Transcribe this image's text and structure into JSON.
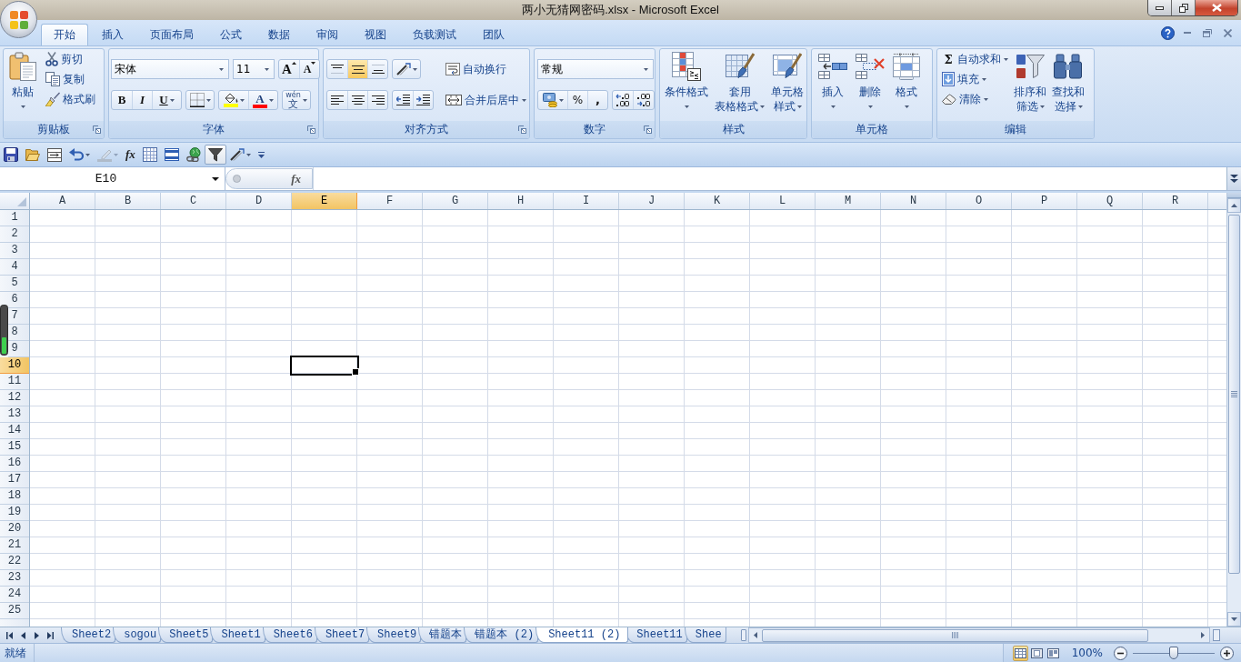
{
  "window": {
    "title": "两小无猜网密码.xlsx - Microsoft Excel"
  },
  "ribbon_tabs": [
    {
      "label": "开始",
      "selected": true
    },
    {
      "label": "插入",
      "selected": false
    },
    {
      "label": "页面布局",
      "selected": false
    },
    {
      "label": "公式",
      "selected": false
    },
    {
      "label": "数据",
      "selected": false
    },
    {
      "label": "审阅",
      "selected": false
    },
    {
      "label": "视图",
      "selected": false
    },
    {
      "label": "负载测试",
      "selected": false
    },
    {
      "label": "团队",
      "selected": false
    }
  ],
  "ribbon_groups": [
    {
      "title": "剪贴板",
      "launcher": true,
      "columns": [
        {
          "kind": "large",
          "lines": [
            "粘贴"
          ],
          "menu": true
        },
        {
          "kind": "stack",
          "rows": [
            {
              "controls": [
                {
                  "kind": "small",
                  "label": "剪切"
                }
              ]
            },
            {
              "controls": [
                {
                  "kind": "small",
                  "label": "复制"
                }
              ]
            },
            {
              "controls": [
                {
                  "kind": "small",
                  "label": "格式刷"
                }
              ]
            }
          ]
        }
      ]
    },
    {
      "title": "字体",
      "launcher": true,
      "columns": [
        {
          "kind": "stack",
          "rows": [
            {
              "controls": [
                {
                  "kind": "combo",
                  "value": "宋体"
                },
                {
                  "kind": "combo",
                  "value": "11"
                },
                {
                  "kind": "segmented",
                  "buttons": [
                    {
                      "text": "A",
                      "selected": false
                    },
                    {
                      "text": "A",
                      "selected": false
                    }
                  ]
                }
              ]
            },
            {
              "controls": [
                {
                  "kind": "segmented",
                  "buttons": [
                    {
                      "text": "B",
                      "selected": false
                    },
                    {
                      "text": "I",
                      "selected": false
                    },
                    {
                      "text": "U",
                      "selected": false,
                      "menu": true
                    }
                  ]
                },
                {
                  "kind": "segmented",
                  "buttons": [
                    {
                      "selected": false,
                      "menu": true
                    }
                  ]
                },
                {
                  "kind": "segmented",
                  "buttons": [
                    {
                      "selected": false,
                      "menu": true,
                      "color": "#ffff00"
                    },
                    {
                      "text": "A",
                      "selected": false,
                      "menu": true,
                      "color": "#ff0000"
                    }
                  ]
                },
                {
                  "kind": "segmented",
                  "buttons": [
                    {
                      "ruby": "wén",
                      "text": "文",
                      "selected": false,
                      "menu": true
                    }
                  ]
                }
              ]
            }
          ]
        }
      ]
    },
    {
      "title": "对齐方式",
      "launcher": true,
      "columns": [
        {
          "kind": "stack",
          "rows": [
            {
              "controls": [
                {
                  "kind": "segmented",
                  "buttons": [
                    {
                      "selected": false
                    },
                    {
                      "selected": true
                    },
                    {
                      "selected": false
                    }
                  ]
                },
                {
                  "kind": "segmented",
                  "buttons": [
                    {
                      "selected": false,
                      "menu": true
                    }
                  ]
                }
              ]
            },
            {
              "controls": [
                {
                  "kind": "segmented",
                  "buttons": [
                    {
                      "selected": false
                    },
                    {
                      "selected": false
                    },
                    {
                      "selected": false
                    }
                  ]
                },
                {
                  "kind": "segmented",
                  "buttons": [
                    {
                      "selected": false
                    },
                    {
                      "selected": false
                    }
                  ]
                }
              ]
            }
          ]
        },
        {
          "kind": "separator"
        },
        {
          "kind": "stack",
          "rows": [
            {
              "controls": [
                {
                  "kind": "small",
                  "label": "自动换行"
                }
              ]
            },
            {
              "controls": [
                {
                  "kind": "small",
                  "label": "合并后居中",
                  "menu": true
                }
              ]
            }
          ]
        }
      ]
    },
    {
      "title": "数字",
      "launcher": true,
      "columns": [
        {
          "kind": "stack",
          "rows": [
            {
              "controls": [
                {
                  "kind": "combo",
                  "value": "常规"
                }
              ]
            },
            {
              "controls": [
                {
                  "kind": "segmented",
                  "buttons": [
                    {
                      "selected": false,
                      "menu": true
                    },
                    {
                      "text": "%",
                      "selected": false
                    },
                    {
                      "text": ",",
                      "selected": false
                    }
                  ]
                },
                {
                  "kind": "segmented",
                  "buttons": [
                    {
                      "selected": false
                    },
                    {
                      "selected": false
                    }
                  ]
                }
              ]
            }
          ]
        }
      ]
    },
    {
      "title": "样式",
      "columns": [
        {
          "kind": "large",
          "lines": [
            "条件格式"
          ],
          "menu": true
        },
        {
          "kind": "large",
          "lines": [
            "套用",
            "表格格式"
          ],
          "menu": true
        },
        {
          "kind": "large",
          "lines": [
            "单元格",
            "样式"
          ],
          "menu": true
        }
      ]
    },
    {
      "title": "单元格",
      "columns": [
        {
          "kind": "large",
          "lines": [
            "插入"
          ],
          "menu": true
        },
        {
          "kind": "large",
          "lines": [
            "删除"
          ],
          "menu": true
        },
        {
          "kind": "large",
          "lines": [
            "格式"
          ],
          "menu": true
        }
      ]
    },
    {
      "title": "编辑",
      "columns": [
        {
          "kind": "stack",
          "rows": [
            {
              "controls": [
                {
                  "kind": "small",
                  "symbol": "Σ",
                  "label": "自动求和",
                  "menu": true
                }
              ]
            },
            {
              "controls": [
                {
                  "kind": "small",
                  "label": "填充",
                  "menu": true
                }
              ]
            },
            {
              "controls": [
                {
                  "kind": "small",
                  "label": "清除",
                  "menu": true
                }
              ]
            }
          ]
        },
        {
          "kind": "large",
          "lines": [
            "排序和",
            "筛选"
          ],
          "menu": true
        },
        {
          "kind": "large",
          "lines": [
            "查找和",
            "选择"
          ],
          "menu": true
        }
      ]
    }
  ],
  "quick_access": [
    {
      "selected": false,
      "disabled": false
    },
    {
      "selected": false,
      "disabled": false
    },
    {
      "selected": false,
      "disabled": false
    },
    {
      "selected": false,
      "disabled": false,
      "menu": true
    },
    {
      "selected": false,
      "disabled": true,
      "menu": true
    },
    {
      "text": "fx",
      "selected": false,
      "disabled": false
    },
    {
      "selected": false,
      "disabled": false
    },
    {
      "selected": false,
      "disabled": false
    },
    {
      "selected": false,
      "disabled": false
    },
    {
      "selected": true,
      "disabled": false
    },
    {
      "selected": false,
      "disabled": false,
      "menu": true
    },
    {
      "selected": false,
      "disabled": false
    }
  ],
  "formula_bar": {
    "name_box": "E10",
    "function_button": "fx"
  },
  "sheet": {
    "columns": [
      {
        "label": "A",
        "selected": false
      },
      {
        "label": "B",
        "selected": false
      },
      {
        "label": "C",
        "selected": false
      },
      {
        "label": "D",
        "selected": false
      },
      {
        "label": "E",
        "selected": true
      },
      {
        "label": "F",
        "selected": false
      },
      {
        "label": "G",
        "selected": false
      },
      {
        "label": "H",
        "selected": false
      },
      {
        "label": "I",
        "selected": false
      },
      {
        "label": "J",
        "selected": false
      },
      {
        "label": "K",
        "selected": false
      },
      {
        "label": "L",
        "selected": false
      },
      {
        "label": "M",
        "selected": false
      },
      {
        "label": "N",
        "selected": false
      },
      {
        "label": "O",
        "selected": false
      },
      {
        "label": "P",
        "selected": false
      },
      {
        "label": "Q",
        "selected": false
      },
      {
        "label": "R",
        "selected": false
      }
    ],
    "rows": [
      {
        "label": "1",
        "selected": false
      },
      {
        "label": "2",
        "selected": false
      },
      {
        "label": "3",
        "selected": false
      },
      {
        "label": "4",
        "selected": false
      },
      {
        "label": "5",
        "selected": false
      },
      {
        "label": "6",
        "selected": false
      },
      {
        "label": "7",
        "selected": false
      },
      {
        "label": "8",
        "selected": false
      },
      {
        "label": "9",
        "selected": false
      },
      {
        "label": "10",
        "selected": true
      },
      {
        "label": "11",
        "selected": false
      },
      {
        "label": "12",
        "selected": false
      },
      {
        "label": "13",
        "selected": false
      },
      {
        "label": "14",
        "selected": false
      },
      {
        "label": "15",
        "selected": false
      },
      {
        "label": "16",
        "selected": false
      },
      {
        "label": "17",
        "selected": false
      },
      {
        "label": "18",
        "selected": false
      },
      {
        "label": "19",
        "selected": false
      },
      {
        "label": "20",
        "selected": false
      },
      {
        "label": "21",
        "selected": false
      },
      {
        "label": "22",
        "selected": false
      },
      {
        "label": "23",
        "selected": false
      },
      {
        "label": "24",
        "selected": false
      },
      {
        "label": "25",
        "selected": false
      }
    ]
  },
  "sheet_tabs": [
    {
      "label": "Sheet2",
      "selected": false
    },
    {
      "label": "sogou",
      "selected": false
    },
    {
      "label": "Sheet5",
      "selected": false
    },
    {
      "label": "Sheet1",
      "selected": false
    },
    {
      "label": "Sheet6",
      "selected": false
    },
    {
      "label": "Sheet7",
      "selected": false
    },
    {
      "label": "Sheet9",
      "selected": false
    },
    {
      "label": "错题本",
      "selected": false
    },
    {
      "label": "错题本 (2)",
      "selected": false
    },
    {
      "label": "Sheet11 (2)",
      "selected": true
    },
    {
      "label": "Sheet11",
      "selected": false
    },
    {
      "label": "Shee",
      "selected": false
    }
  ],
  "status_bar": {
    "text": "就绪",
    "views": [
      {
        "selected": true
      },
      {
        "selected": false
      },
      {
        "selected": false
      }
    ],
    "zoom": "100%",
    "zoom_slider": {
      "level": 0.5
    }
  }
}
